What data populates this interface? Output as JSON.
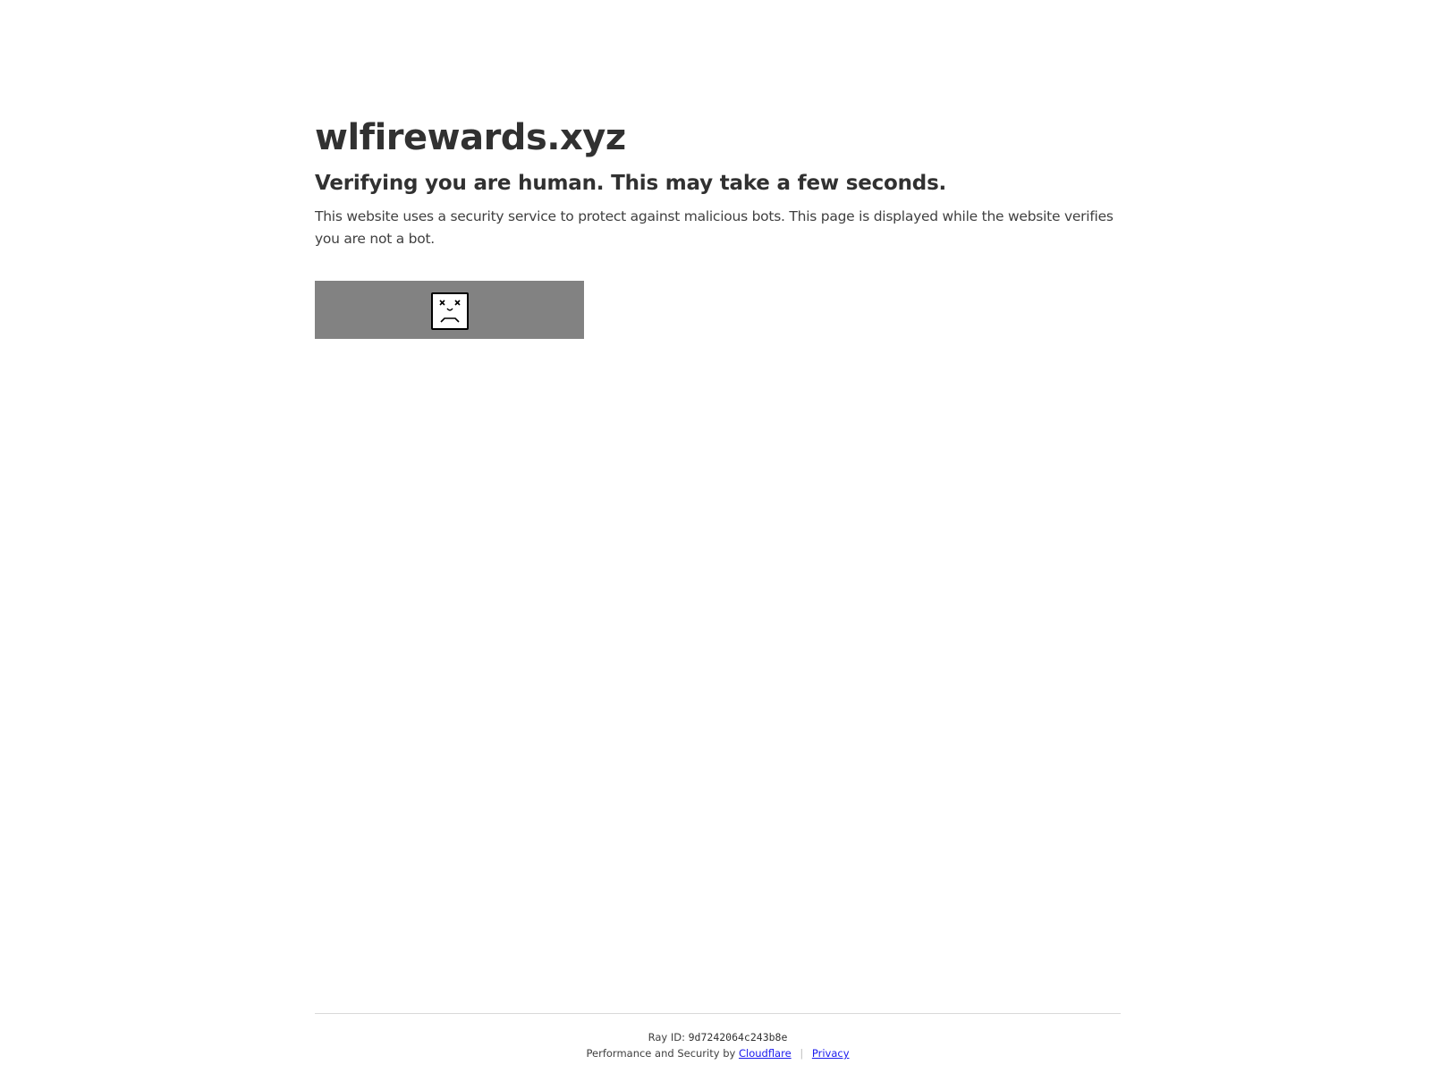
{
  "site": {
    "name": "wlfirewards.xyz"
  },
  "challenge": {
    "heading": "Verifying you are human. This may take a few seconds.",
    "description": "This website uses a security service to protect against malicious bots. This page is displayed while the website verifies you are not a bot.",
    "widget_icon": "sad-face-error-icon"
  },
  "footer": {
    "ray_label": "Ray ID:",
    "ray_id": "9d7242064c243b8e",
    "performance_text": "Performance and Security by",
    "provider_link": "Cloudflare",
    "separator": "|",
    "privacy_link": "Privacy"
  },
  "colors": {
    "text": "#313131",
    "widget_background": "#828282",
    "link": "#1a1aee",
    "divider": "#d9d9d9"
  }
}
